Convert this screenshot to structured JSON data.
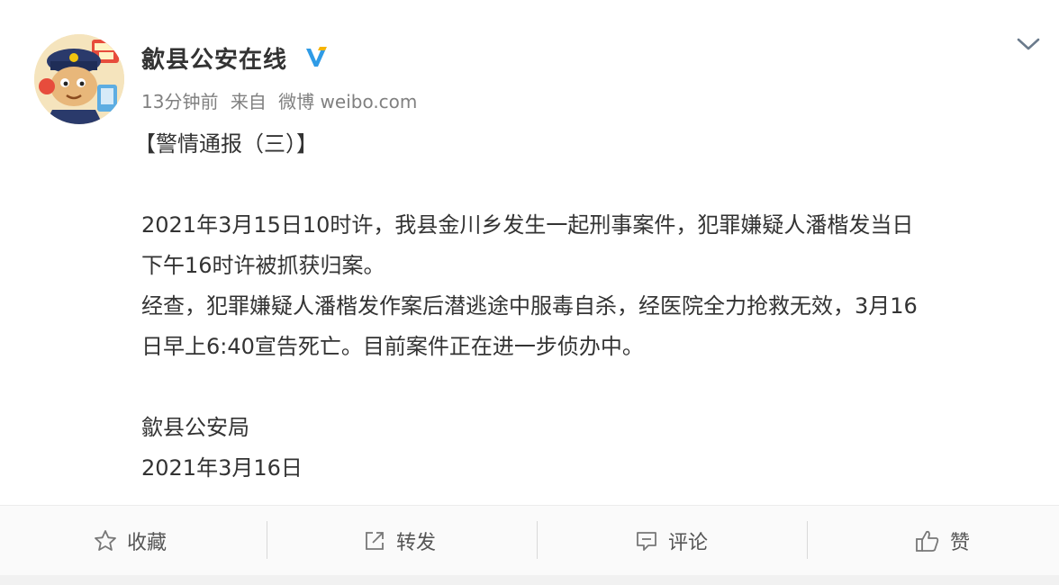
{
  "account": {
    "name": "歙县公安在线",
    "verified_badge": "verified-icon",
    "avatar": "police-mascot-avatar"
  },
  "meta": {
    "time": "13分钟前",
    "from_label": "来自",
    "source": "微博 weibo.com"
  },
  "post": {
    "title": "【警情通报（三）】",
    "lines": [
      "2021年3月15日10时许，我县金川乡发生一起刑事案件，犯罪嫌疑人潘楷发当日",
      "下午16时许被抓获归案。",
      "经查，犯罪嫌疑人潘楷发作案后潜逃途中服毒自杀，经医院全力抢救无效，3月16",
      "日早上6:40宣告死亡。目前案件正在进一步侦办中。"
    ],
    "signature": "歙县公安局",
    "date": "2021年3月16日"
  },
  "actions": {
    "favorite": "收藏",
    "repost": "转发",
    "comment": "评论",
    "like": "赞"
  },
  "colors": {
    "verified": "#2f9be6",
    "meta_text": "#808080",
    "body_text": "#333333"
  }
}
